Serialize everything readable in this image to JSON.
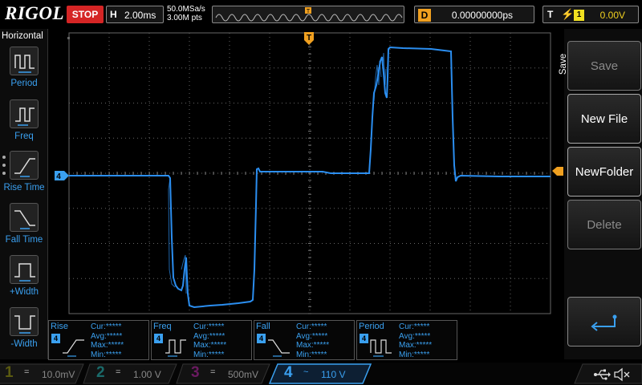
{
  "header": {
    "logo": "RIGOL",
    "run_state": "STOP",
    "timebase_label": "H",
    "timebase_value": "2.00ms",
    "sample_rate": "50.0MSa/s",
    "memory_depth": "3.00M pts",
    "trigger_delay_label": "D",
    "trigger_delay_value": "0.00000000ps",
    "trigger_label": "T",
    "trigger_edge_icon": "rising-edge-icon",
    "trigger_source": "1",
    "trigger_level": "0.00V"
  },
  "left_menu": {
    "title": "Horizontal",
    "items": [
      {
        "label": "Period",
        "icon": "period-icon"
      },
      {
        "label": "Freq",
        "icon": "frequency-icon"
      },
      {
        "label": "Rise Time",
        "icon": "rise-time-icon"
      },
      {
        "label": "Fall Time",
        "icon": "fall-time-icon"
      },
      {
        "label": "+Width",
        "icon": "positive-width-icon"
      },
      {
        "label": "-Width",
        "icon": "negative-width-icon"
      }
    ]
  },
  "right_menu": {
    "title": "Save",
    "buttons": [
      {
        "label": "Save",
        "enabled": false
      },
      {
        "label": "New File",
        "enabled": true
      },
      {
        "label": "NewFolder",
        "enabled": true
      },
      {
        "label": "Delete",
        "enabled": false
      }
    ],
    "return_icon": "return-arrow-icon"
  },
  "markers": {
    "channel_marker": "4",
    "trigger_position_marker": "T"
  },
  "measurements": [
    {
      "name": "Rise",
      "channel": "4",
      "icon": "rise-time-icon",
      "cur": "*****",
      "avg": "*****",
      "max": "*****",
      "min": "*****"
    },
    {
      "name": "Freq",
      "channel": "4",
      "icon": "frequency-icon",
      "cur": "*****",
      "avg": "*****",
      "max": "*****",
      "min": "*****"
    },
    {
      "name": "Fall",
      "channel": "4",
      "icon": "fall-time-icon",
      "cur": "*****",
      "avg": "*****",
      "max": "*****",
      "min": "*****"
    },
    {
      "name": "Period",
      "channel": "4",
      "icon": "period-icon",
      "cur": "*****",
      "avg": "*****",
      "max": "*****",
      "min": "*****"
    }
  ],
  "stat_labels": {
    "cur": "Cur:",
    "avg": "Avg:",
    "max": "Max:",
    "min": "Min:"
  },
  "channels": [
    {
      "number": "1",
      "scale": "10.0mV",
      "color": "#d8d020",
      "coupling": "="
    },
    {
      "number": "2",
      "scale": "1.00 V",
      "color": "#40d0d0",
      "coupling": "="
    },
    {
      "number": "3",
      "scale": "500mV",
      "color": "#d040c0",
      "coupling": "="
    },
    {
      "number": "4",
      "scale": "110 V",
      "color": "#3aa0f0",
      "coupling": "~",
      "active": true
    }
  ],
  "status_icons": [
    "usb-icon",
    "speaker-mute-icon"
  ],
  "colors": {
    "trace": "#2b8ef0",
    "stop": "#d52525",
    "trigger": "#f0a020",
    "grid": "#555555"
  }
}
